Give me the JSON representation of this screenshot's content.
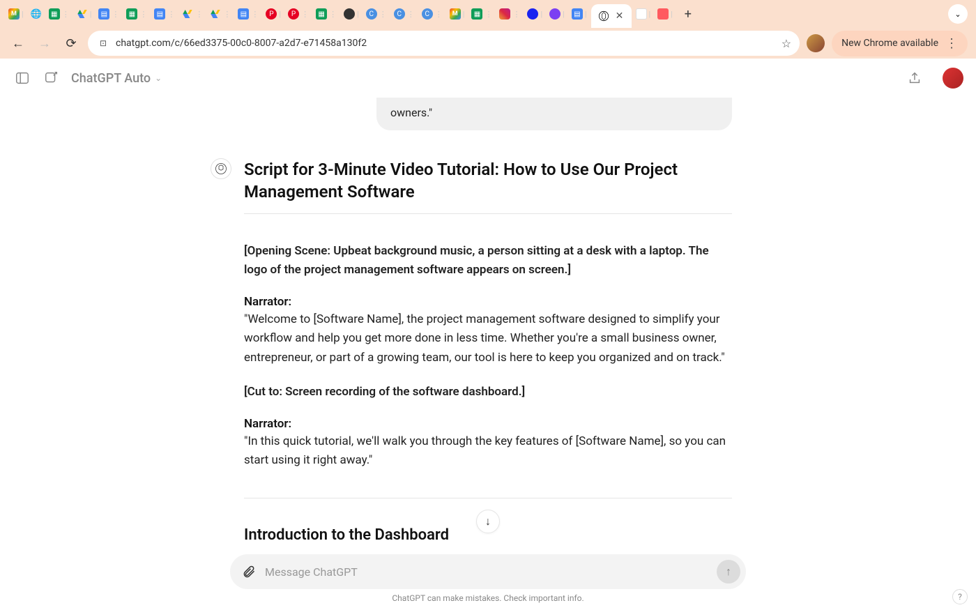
{
  "browser": {
    "url": "chatgpt.com/c/66ed3375-00c0-8007-a2d7-e71458a130f2",
    "chrome_available": "New Chrome available"
  },
  "header": {
    "model": "ChatGPT Auto"
  },
  "user_message": "owners.\"",
  "response": {
    "title": "Script for 3-Minute Video Tutorial: How to Use Our Project Management Software",
    "scene1": "[Opening Scene: Upbeat background music, a person sitting at a desk with a laptop. The logo of the project management software appears on screen.]",
    "narrator_label": "Narrator:",
    "narrator1": "\"Welcome to [Software Name], the project management software designed to simplify your workflow and help you get more done in less time. Whether you're a small business owner, entrepreneur, or part of a growing team, our tool is here to keep you organized and on track.\"",
    "scene2": "[Cut to: Screen recording of the software dashboard.]",
    "narrator2": "\"In this quick tutorial, we'll walk you through the key features of [Software Name], so you can start using it right away.\"",
    "section_heading": "Introduction to the Dashboard"
  },
  "input": {
    "placeholder": "Message ChatGPT",
    "disclaimer": "ChatGPT can make mistakes. Check important info."
  }
}
